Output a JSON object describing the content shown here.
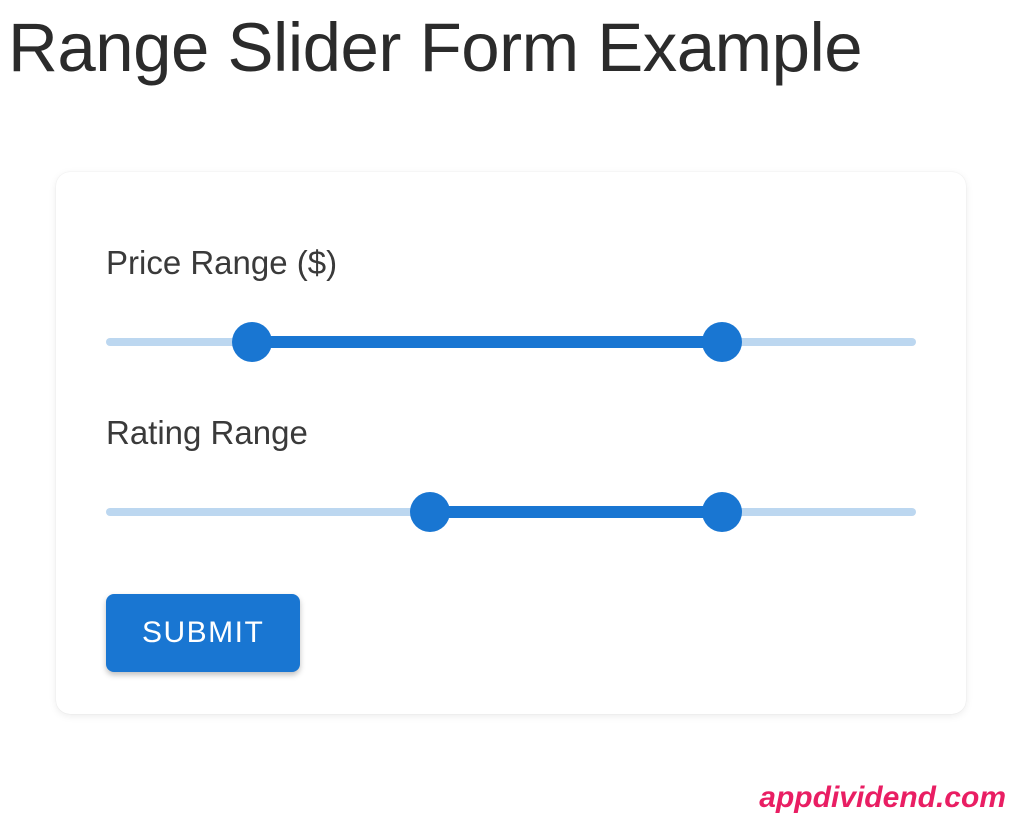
{
  "header": {
    "title": "Range Slider Form Example"
  },
  "form": {
    "sliders": [
      {
        "label": "Price Range ($)",
        "low_percent": 18,
        "high_percent": 76
      },
      {
        "label": "Rating Range",
        "low_percent": 40,
        "high_percent": 76
      }
    ],
    "submit_label": "SUBMIT"
  },
  "watermark": "appdividend.com",
  "colors": {
    "primary": "#1976d2",
    "rail": "#bcd7f0",
    "accent": "#e91e63"
  }
}
